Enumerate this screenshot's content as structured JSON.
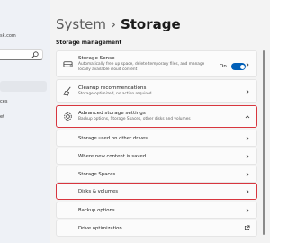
{
  "sidebar": {
    "account_email": "sk.com",
    "nav_fragments": [
      "ces",
      "et"
    ]
  },
  "breadcrumb": {
    "parent": "System",
    "separator": "›",
    "current": "Storage"
  },
  "section_title": "Storage management",
  "storage_sense": {
    "title": "Storage Sense",
    "description": "Automatically free up space, delete temporary files, and manage locally available cloud content",
    "toggle_label": "On",
    "toggle_on": true
  },
  "cleanup": {
    "title": "Cleanup recommendations",
    "description": "Storage optimized, no action required"
  },
  "advanced": {
    "title": "Advanced storage settings",
    "description": "Backup options, Storage Spaces, other disks and volumes",
    "expanded": true,
    "items": [
      {
        "label": "Storage used on other drives"
      },
      {
        "label": "Where new content is saved"
      },
      {
        "label": "Storage Spaces"
      },
      {
        "label": "Disks & volumes"
      },
      {
        "label": "Backup options"
      },
      {
        "label": "Drive optimization"
      }
    ]
  },
  "colors": {
    "accent": "#005fb8",
    "highlight_border": "#d8363e",
    "card_bg": "#fbfbfb",
    "page_bg": "#f3f3f3"
  },
  "icons": {
    "storage_sense": "storage-drive-icon",
    "cleanup": "broom-icon",
    "advanced": "gear-icon",
    "drive_optimization": "open-external-icon"
  }
}
